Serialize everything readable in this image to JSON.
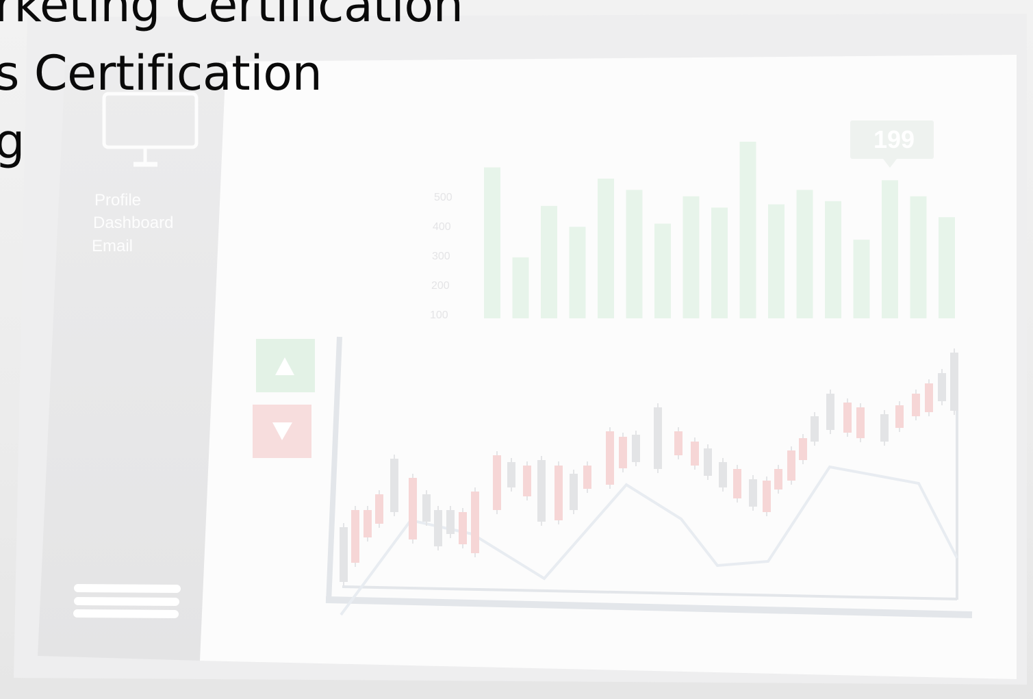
{
  "heading_lines": [
    "rketing Certification",
    "s Certification",
    "g"
  ],
  "screen": {
    "menu_items": [
      "Profile",
      "Dashboard",
      "Email"
    ],
    "callout_value": "199",
    "bar_axis_ticks": [
      "500",
      "400",
      "300",
      "200",
      "100"
    ],
    "trend_up_label": "▲",
    "trend_down_label": "▼"
  },
  "icons": {
    "monitor": "monitor-icon",
    "menu": "hamburger-menu-icon"
  },
  "colors": {
    "bar_green": "#e7f4ea",
    "candle_red": "#f6d6d6",
    "candle_grey": "#e3e4e6",
    "up_button": "#e3f2e6",
    "down_button": "#f7dddd",
    "sidebar": "#e9e9ea"
  },
  "chart_data": {
    "type": "bar",
    "categories": [],
    "values": [
      470,
      190,
      350,
      285,
      435,
      400,
      295,
      380,
      345,
      550,
      355,
      400,
      365,
      245,
      430,
      380,
      315
    ],
    "ylim": [
      0,
      550
    ],
    "xlabel": "",
    "ylabel": "",
    "title": ""
  }
}
